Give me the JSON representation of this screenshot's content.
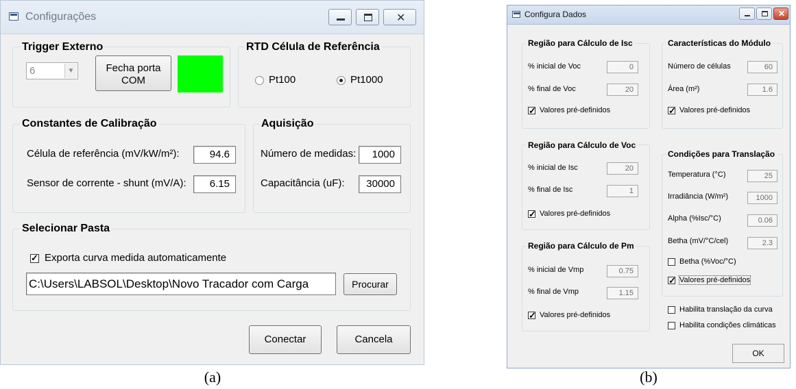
{
  "window_a": {
    "title": "Configurações",
    "trigger": {
      "label": "Trigger Externo",
      "port_value": "6",
      "button": "Fecha porta COM",
      "button_line1": "Fecha porta",
      "button_line2": "COM",
      "status_color": "#00ff00"
    },
    "rtd": {
      "label": "RTD Célula de Referência",
      "opt1": "Pt100",
      "opt2": "Pt1000",
      "selected": "Pt1000"
    },
    "calib": {
      "label": "Constantes de Calibração",
      "ref_label": "Célula de referência (mV/kW/m²):",
      "ref_value": "94.6",
      "shunt_label": "Sensor de corrente - shunt (mV/A):",
      "shunt_value": "6.15"
    },
    "aquis": {
      "label": "Aquisição",
      "n_label": "Número de medidas:",
      "n_value": "1000",
      "cap_label": "Capacitância (uF):",
      "cap_value": "30000"
    },
    "folder": {
      "label": "Selecionar Pasta",
      "export_label": "Exporta curva medida automaticamente",
      "export_checked": true,
      "path": "C:\\Users\\LABSOL\\Desktop\\Novo Tracador com Carga",
      "browse": "Procurar"
    },
    "connect": "Conectar",
    "cancel": "Cancela"
  },
  "window_b": {
    "title": "Configura Dados",
    "isc": {
      "label": "Região para Cálculo de Isc",
      "r1_label": "% inicial de Voc",
      "r1_value": "0",
      "r2_label": "% final de Voc",
      "r2_value": "20",
      "predef": "Valores pré-definidos"
    },
    "voc": {
      "label": "Região para Cálculo de Voc",
      "r1_label": "% inicial de Isc",
      "r1_value": "20",
      "r2_label": "% final de Isc",
      "r2_value": "1",
      "predef": "Valores pré-definidos"
    },
    "pm": {
      "label": "Região para Cálculo de Pm",
      "r1_label": "% inicial de Vmp",
      "r1_value": "0.75",
      "r2_label": "% final de Vmp",
      "r2_value": "1.15",
      "predef": "Valores pré-definidos"
    },
    "modulo": {
      "label": "Características do Módulo",
      "r1_label": "Número de células",
      "r1_value": "60",
      "r2_label": "Área (m²)",
      "r2_value": "1.6",
      "predef": "Valores pré-definidos"
    },
    "trans": {
      "label": "Condições para Translação",
      "t_label": "Temperatura (°C)",
      "t_value": "25",
      "g_label": "Irradiância (W/m²)",
      "g_value": "1000",
      "a_label": "Alpha (%Isc/°C)",
      "a_value": "0.06",
      "b_label": "Betha (mV/°C/cel)",
      "b_value": "2.3",
      "bpct": "Betha (%Voc/°C)",
      "predef": "Valores pré-definidos"
    },
    "habilita_curva": "Habilita translação da curva",
    "habilita_clima": "Habilita condições climáticas",
    "ok": "OK"
  },
  "captions": {
    "a": "(a)",
    "b": "(b)"
  }
}
